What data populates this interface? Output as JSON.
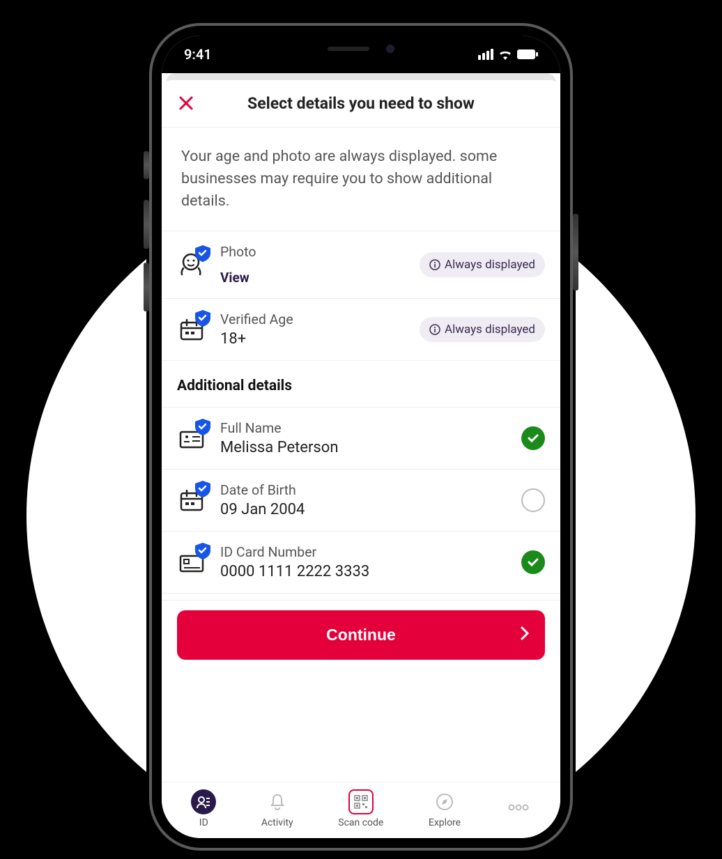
{
  "status": {
    "time": "9:41"
  },
  "header": {
    "title": "Select details you need to show"
  },
  "intro": "Your age and photo are always displayed. some businesses may require you to show additional details.",
  "always": [
    {
      "label": "Photo",
      "action": "View",
      "badge": "Always displayed"
    },
    {
      "label": "Verified Age",
      "value": "18+",
      "badge": "Always displayed"
    }
  ],
  "additionalHeader": "Additional details",
  "additional": [
    {
      "label": "Full Name",
      "value": "Melissa Peterson",
      "checked": true
    },
    {
      "label": "Date of Birth",
      "value": "09 Jan 2004",
      "checked": false
    },
    {
      "label": "ID Card Number",
      "value": "0000 1111 2222 3333",
      "checked": true
    }
  ],
  "cta": "Continue",
  "nav": [
    {
      "label": "ID"
    },
    {
      "label": "Activity"
    },
    {
      "label": "Scan code"
    },
    {
      "label": "Explore"
    },
    {
      "label": ""
    }
  ],
  "colors": {
    "accent": "#e4003a",
    "shield": "#1754e8",
    "check": "#1a8a1a"
  }
}
